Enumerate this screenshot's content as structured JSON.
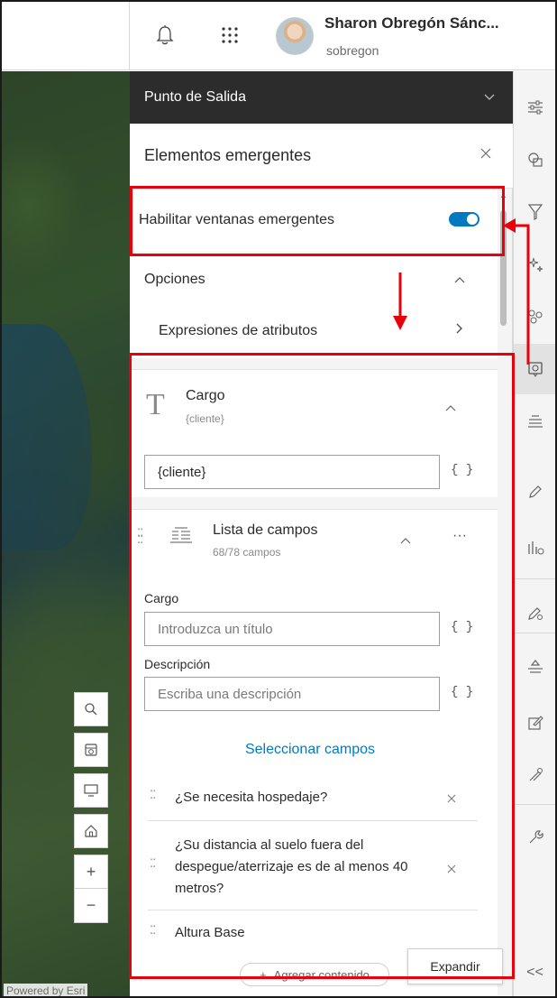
{
  "header": {
    "user_name": "Sharon Obregón Sánc...",
    "user_login": "sobregon",
    "icons": [
      "bell-icon",
      "app-launcher-icon"
    ]
  },
  "map": {
    "attribution": "Powered by Esri",
    "tools": [
      "search-icon",
      "basemap-icon",
      "monitor-icon",
      "home-icon",
      "zoom-in-icon",
      "zoom-out-icon"
    ],
    "zoom_in": "+",
    "zoom_out": "−"
  },
  "panel": {
    "layer_name": "Punto de Salida",
    "title": "Elementos emergentes",
    "toggle_label": "Habilitar ventanas emergentes",
    "toggle_on": true,
    "options_label": "Opciones",
    "attr_expressions_label": "Expresiones de atributos",
    "title_card": {
      "title": "Cargo",
      "subtitle": "{cliente}",
      "value": "{cliente}",
      "braces": "{ }"
    },
    "fields_card": {
      "title": "Lista de campos",
      "subtitle": "68/78 campos",
      "more": "···",
      "title_label": "Cargo",
      "title_placeholder": "Introduzca un título",
      "desc_label": "Descripción",
      "desc_placeholder": "Escriba una descripción",
      "braces": "{ }",
      "select_fields": "Seleccionar campos",
      "fields": [
        "¿Se necesita hospedaje?",
        "¿Su distancia al suelo fuera del despegue/aterrizaje es de al menos 40 metros?",
        "Altura Base"
      ]
    },
    "add_content": "Agregar contenido",
    "expand": "Expandir"
  },
  "rail": {
    "items": [
      "properties-icon",
      "styles-icon",
      "filter-icon",
      "effects-icon",
      "clustering-icon",
      "popups-icon",
      "labels-icon",
      "edit-icon",
      "charts-icon",
      "field-settings-icon",
      "forms-icon",
      "sketch-icon",
      "config-icon",
      "tools-icon"
    ],
    "active_index": 5,
    "collapse": "<<"
  },
  "annotation_color": "#e8000b",
  "accent_color": "#0079c1"
}
